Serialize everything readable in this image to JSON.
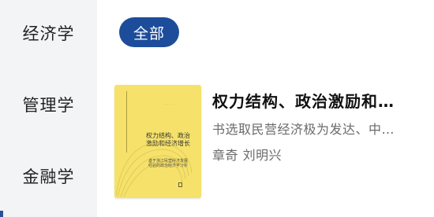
{
  "sidebar": {
    "items": [
      {
        "label": "经济学"
      },
      {
        "label": "管理学"
      },
      {
        "label": "金融学"
      }
    ]
  },
  "filter": {
    "chip_label": "全部"
  },
  "book": {
    "title": "权力结构、政治激励和…",
    "description": "书选取民营经济极为发达、中…",
    "authors": "章奇  刘明兴",
    "cover": {
      "title_lines": [
        "权力结构、政治",
        "激励和经济增长"
      ],
      "subtitle_lines": [
        "基于浙江民营经济发展",
        "经验的政治经济学分析"
      ],
      "background_color": "#f6e26a"
    }
  },
  "colors": {
    "accent": "#1d4d9a",
    "sidebar_bg": "#f3f4f6",
    "muted_text": "#6b6b6b"
  }
}
